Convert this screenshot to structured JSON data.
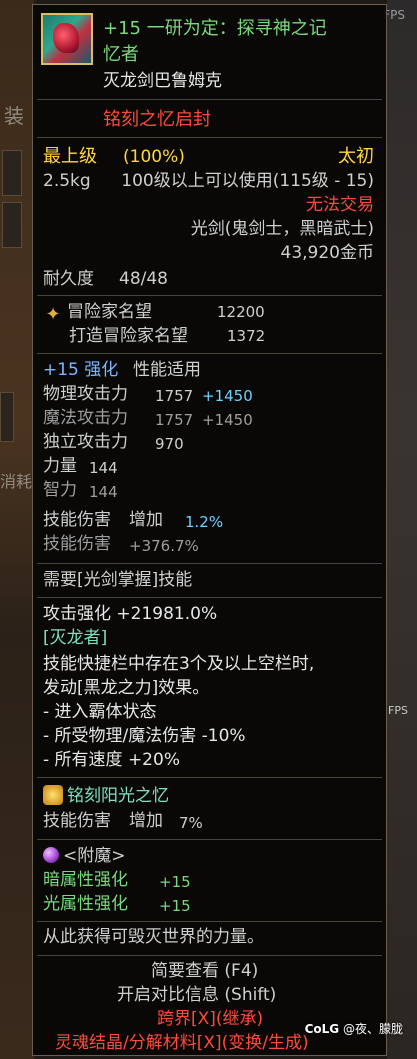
{
  "background": {
    "fps_label": "FPS",
    "frag1": "装",
    "frag2": "消耗",
    "frag3": "FPS"
  },
  "item": {
    "icon": "item-icon",
    "name_line1": "+15 一研为定：探寻神之记",
    "name_line2": "忆者",
    "subtitle": "灭龙剑巴鲁姆克",
    "seal": "铭刻之忆启封",
    "grade": "最上级",
    "grade_pct": "(100%)",
    "rarity": "太初",
    "weight": "2.5kg",
    "level_req": "100级以上可以使用(115级 - 15)",
    "trade": "无法交易",
    "weapon_type": "光剑(鬼剑士，黑暗武士)",
    "price": "43,920金币",
    "durability_label": "耐久度",
    "durability": "48/48"
  },
  "fame": {
    "icon": "adventurer-fame-icon",
    "label": "冒险家名望",
    "value": "12200",
    "forge_label": "打造冒险家名望",
    "forge_value": "1372"
  },
  "stats": {
    "reinforce": "+15 强化",
    "reinforce_suffix": "性能适用",
    "phys_atk_label": "物理攻击力",
    "phys_atk": "1757",
    "phys_atk_bonus": "+1450",
    "mag_atk_label": "魔法攻击力",
    "mag_atk": "1757",
    "mag_atk_bonus": "+1450",
    "ind_atk_label": "独立攻击力",
    "ind_atk": "970",
    "str_label": "力量",
    "str": "144",
    "int_label": "智力",
    "int": "144",
    "skill1_label": "技能伤害",
    "skill1_mid": "增加",
    "skill1_val": "1.2%",
    "skill2_label": "技能伤害",
    "skill2_val": "+376.7%"
  },
  "mastery": {
    "req": "需要[光剑掌握]技能"
  },
  "effect": {
    "atk_boost": "攻击强化 +21981.0%",
    "dragon": "[灭龙者]",
    "desc1": "技能快捷栏中存在3个及以上空栏时,",
    "desc2": "发动[黑龙之力]效果。",
    "b1": "- 进入霸体状态",
    "b2": "- 所受物理/魔法伤害 -10%",
    "b3": "- 所有速度 +20%"
  },
  "inscription": {
    "icon": "sun-memory-icon",
    "name": "铭刻阳光之忆",
    "skill_label": "技能伤害",
    "skill_mid": "增加",
    "skill_val": "7%"
  },
  "enchant": {
    "icon": "enchant-orb-icon",
    "title": "<附魔>",
    "dark_label": "暗属性强化",
    "dark_val": "+15",
    "light_label": "光属性强化",
    "light_val": "+15"
  },
  "flavor": "从此获得可毁灭世界的力量。",
  "footer": {
    "brief": "简要查看 (F4)",
    "compare": "开启对比信息 (Shift)",
    "cross": "跨界[X](继承)",
    "soul": "灵魂结晶/分解材料[X](变换/生成)"
  },
  "watermark": {
    "site": "CoLG",
    "user": "@夜、朦胧"
  }
}
